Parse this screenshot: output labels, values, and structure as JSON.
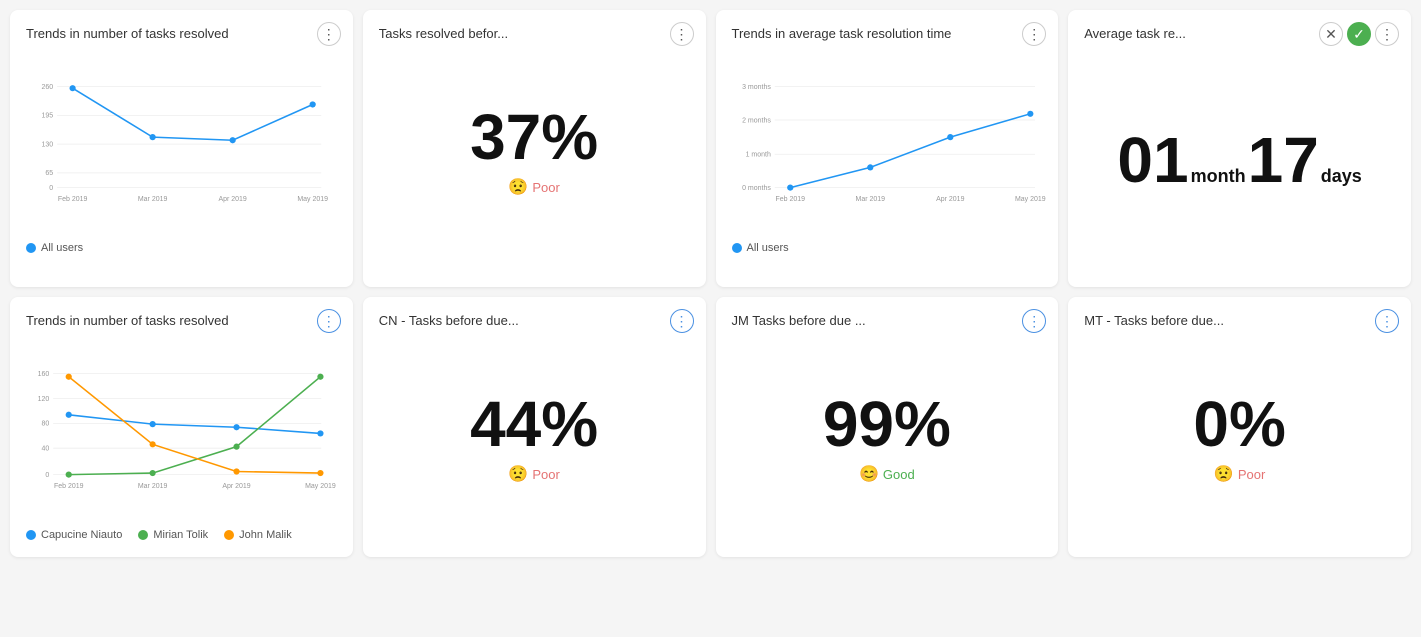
{
  "cards": {
    "top_left": {
      "title": "Trends in number of tasks resolved",
      "legend": [
        {
          "label": "All users",
          "color": "#2196f3"
        }
      ],
      "xLabels": [
        "Feb 2019",
        "Mar 2019",
        "Apr 2019",
        "May 2019"
      ],
      "yLabels": [
        "0",
        "65",
        "130",
        "195",
        "260"
      ],
      "data": [
        {
          "x": 0,
          "y": 255
        },
        {
          "x": 1,
          "y": 130
        },
        {
          "x": 2,
          "y": 120
        },
        {
          "x": 3,
          "y": 215
        }
      ]
    },
    "top_center_left": {
      "title": "Tasks resolved befor...",
      "value": "37%",
      "status": "Poor",
      "statusType": "poor"
    },
    "top_center_right": {
      "title": "Trends in average task resolution time",
      "legend": [
        {
          "label": "All users",
          "color": "#2196f3"
        }
      ],
      "xLabels": [
        "Feb 2019",
        "Mar 2019",
        "Apr 2019",
        "May 2019"
      ],
      "yLabels": [
        "0 months",
        "1 month",
        "2 months",
        "3 months"
      ],
      "data": [
        {
          "x": 0,
          "y": 0
        },
        {
          "x": 1,
          "y": 0.6
        },
        {
          "x": 2,
          "y": 1.5
        },
        {
          "x": 3,
          "y": 2.2
        }
      ]
    },
    "top_right": {
      "title": "Average task re...",
      "months": "01",
      "month_label": "month",
      "days": "17",
      "days_label": "days"
    },
    "bottom_left": {
      "title": "Trends in number of tasks resolved",
      "legend": [
        {
          "label": "Capucine Niauto",
          "color": "#2196f3"
        },
        {
          "label": "Mirian Tolik",
          "color": "#4caf50"
        },
        {
          "label": "John Malik",
          "color": "#ff9800"
        }
      ],
      "xLabels": [
        "Feb 2019",
        "Mar 2019",
        "Apr 2019",
        "May 2019"
      ],
      "yLabels": [
        "0",
        "40",
        "80",
        "120",
        "160"
      ],
      "series": [
        {
          "color": "#2196f3",
          "data": [
            {
              "x": 0,
              "y": 95
            },
            {
              "x": 1,
              "y": 80
            },
            {
              "x": 2,
              "y": 75
            },
            {
              "x": 3,
              "y": 65
            }
          ]
        },
        {
          "color": "#4caf50",
          "data": [
            {
              "x": 0,
              "y": 0
            },
            {
              "x": 1,
              "y": 2
            },
            {
              "x": 2,
              "y": 45
            },
            {
              "x": 3,
              "y": 155
            }
          ]
        },
        {
          "color": "#ff9800",
          "data": [
            {
              "x": 0,
              "y": 155
            },
            {
              "x": 1,
              "y": 48
            },
            {
              "x": 2,
              "y": 5
            },
            {
              "x": 3,
              "y": 2
            }
          ]
        }
      ]
    },
    "bottom_cn": {
      "title": "CN - Tasks before due...",
      "value": "44%",
      "status": "Poor",
      "statusType": "poor"
    },
    "bottom_jm": {
      "title": "JM Tasks before due ...",
      "value": "99%",
      "status": "Good",
      "statusType": "good"
    },
    "bottom_mt": {
      "title": "MT - Tasks before due...",
      "value": "0%",
      "status": "Poor",
      "statusType": "poor"
    }
  }
}
